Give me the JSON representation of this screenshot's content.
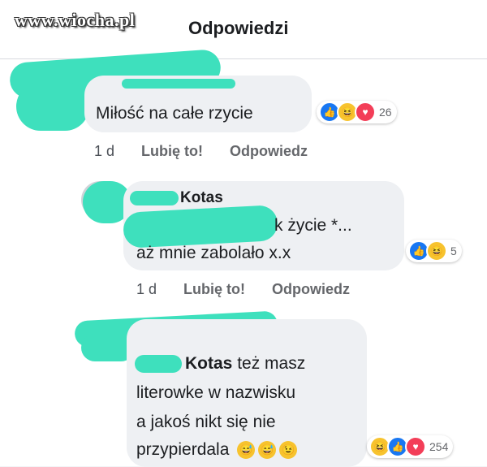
{
  "watermark": "www.wiocha.pl",
  "header": {
    "title": "Odpowiedzi"
  },
  "comments": [
    {
      "text": "Miłość na całe rzycie",
      "reactions": {
        "count": "26",
        "icons": [
          "like-icon",
          "haha-icon",
          "love-icon"
        ]
      },
      "meta": {
        "time": "1 d",
        "like": "Lubię to!",
        "reply": "Odpowiedz"
      }
    },
    {
      "author": "Kotas",
      "line1": "k życie *...",
      "line2": "aż mnie zabolało x.x",
      "reactions": {
        "count": "5",
        "icons": [
          "like-icon",
          "haha-icon"
        ]
      },
      "meta": {
        "time": "1 d",
        "like": "Lubię to!",
        "reply": "Odpowiedz"
      }
    },
    {
      "mention": "Kotas",
      "line1_rest": " też masz",
      "line2": "literowke w nazwisku",
      "line3": "a jakoś nikt się nie",
      "line4": "przypierdala",
      "emojis": [
        "😅",
        "😅",
        "😉"
      ],
      "reactions": {
        "count": "254",
        "icons": [
          "haha-icon",
          "like-icon",
          "love-icon"
        ]
      }
    }
  ],
  "colors": {
    "scribble": "#3ee0bd",
    "bubble": "#eef0f3",
    "like": "#1877f2",
    "love": "#f33e58",
    "haha": "#f7c32e"
  }
}
